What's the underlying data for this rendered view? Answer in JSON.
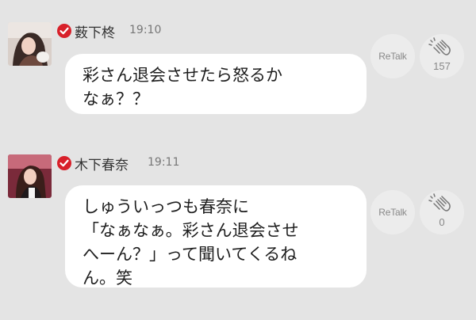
{
  "posts": [
    {
      "author": "薮下柊",
      "time": "19:10",
      "message": "彩さん退会させたら怒るか\nなぁ？？",
      "retalk_label": "ReTalk",
      "clap_count": "157"
    },
    {
      "author": "木下春奈",
      "time": "19:11",
      "message": "しゅういっつも春奈に\n「なぁなぁ。彩さん退会させ\nへーん？」って聞いてくるね\nん。笑",
      "retalk_label": "ReTalk",
      "clap_count": "0"
    }
  ],
  "colors": {
    "background": "#e4e4e4",
    "bubble": "#ffffff",
    "verified_badge": "#d8202a",
    "action_button": "#ececec"
  },
  "icons": {
    "verified": "verified-badge-icon",
    "clap": "clapping-hands-icon"
  }
}
